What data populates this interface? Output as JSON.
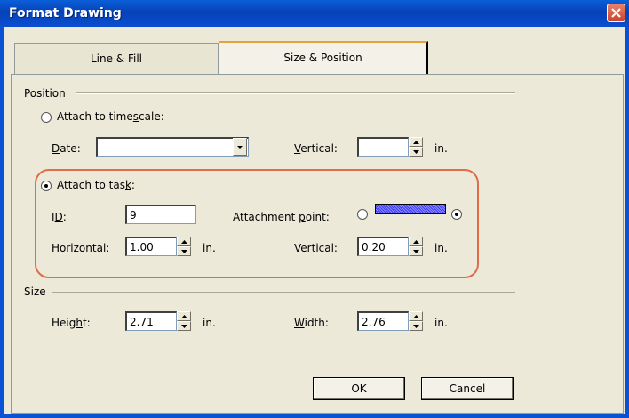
{
  "window": {
    "title": "Format Drawing",
    "close_icon": "close-icon"
  },
  "tabs": [
    {
      "label": "Line & Fill"
    },
    {
      "label": "Size & Position",
      "selected": true
    }
  ],
  "position": {
    "heading": "Position",
    "attach_timescale": {
      "label_pre": "Attach to time",
      "label_u": "s",
      "label_post": "cale:",
      "checked": false
    },
    "date": {
      "label_u": "D",
      "label_post": "ate:",
      "value": ""
    },
    "vertical_ts": {
      "label_u": "V",
      "label_post": "ertical:",
      "value": "",
      "unit": "in."
    },
    "attach_task": {
      "label_pre": "Attach to tas",
      "label_u": "k",
      "label_post": ":",
      "checked": true
    },
    "id": {
      "label_pre": "I",
      "label_u": "D",
      "label_post": ":",
      "value": "9"
    },
    "attachment_point": {
      "label_pre": "Attachment ",
      "label_u": "p",
      "label_post": "oint:",
      "left_selected": false,
      "right_selected": true
    },
    "horizontal": {
      "label_pre": "Horizon",
      "label_u": "t",
      "label_post": "al:",
      "value": "1.00",
      "unit": "in."
    },
    "vertical_task": {
      "label_pre": "Ve",
      "label_u": "r",
      "label_post": "tical:",
      "value": "0.20",
      "unit": "in."
    }
  },
  "size": {
    "heading": "Size",
    "height": {
      "label_pre": "Heig",
      "label_u": "h",
      "label_post": "t:",
      "value": "2.71",
      "unit": "in."
    },
    "width": {
      "label_u": "W",
      "label_post": "idth:",
      "value": "2.76",
      "unit": "in."
    }
  },
  "buttons": {
    "ok": "OK",
    "cancel": "Cancel"
  },
  "colors": {
    "highlight": "#e06c4a",
    "titlebar": "#0a52d4"
  }
}
